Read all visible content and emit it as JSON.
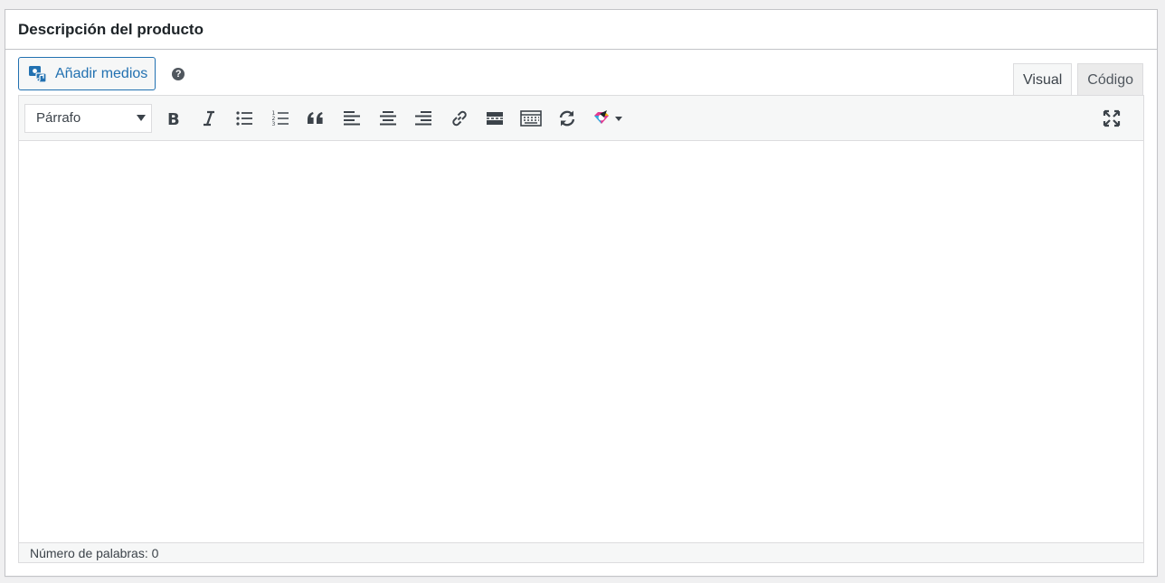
{
  "panel": {
    "title": "Descripción del producto"
  },
  "media": {
    "add_label": "Añadir medios",
    "help_glyph": "?"
  },
  "tabs": [
    {
      "label": "Visual",
      "active": true
    },
    {
      "label": "Código",
      "active": false
    }
  ],
  "toolbar": {
    "format_selected": "Párrafo",
    "buttons": [
      "bold-icon",
      "italic-icon",
      "bullet-list-icon",
      "numbered-list-icon",
      "blockquote-icon",
      "align-left-icon",
      "align-center-icon",
      "align-right-icon",
      "link-icon",
      "read-more-icon",
      "toolbar-toggle-icon",
      "refresh-icon",
      "plugin-rocket-icon",
      "fullscreen-icon"
    ]
  },
  "status": {
    "word_count": "Número de palabras: 0"
  },
  "colors": {
    "accent": "#2271b1",
    "border": "#dcdcde",
    "toolbar_bg": "#f6f7f7",
    "text": "#3c434a"
  }
}
